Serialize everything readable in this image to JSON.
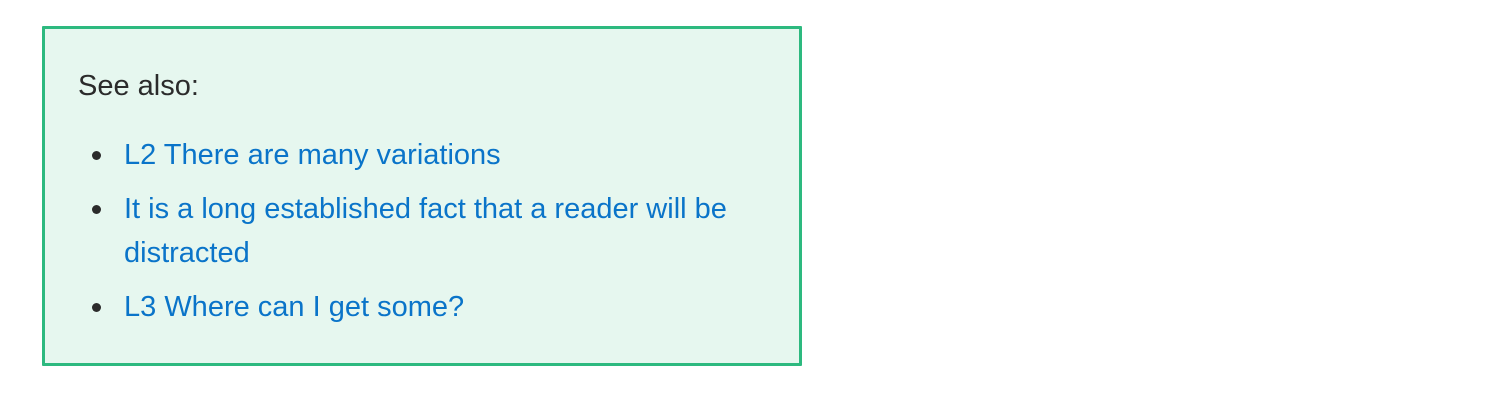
{
  "see_also": {
    "heading": "See also:",
    "links": [
      {
        "label": "L2 There are many variations"
      },
      {
        "label": "It is a long established fact that a reader will be distracted"
      },
      {
        "label": "L3 Where can I get some?"
      }
    ]
  },
  "colors": {
    "box_border": "#2db97f",
    "box_background": "#e6f7ef",
    "link": "#0a74c9",
    "text": "#2b2b2b"
  }
}
